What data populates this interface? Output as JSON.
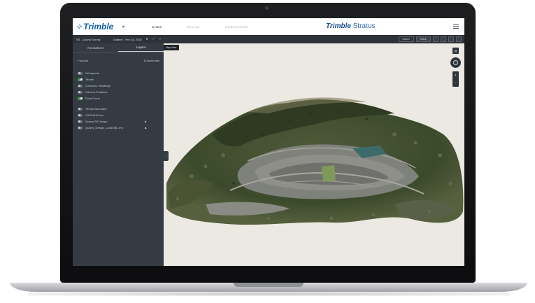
{
  "topbar": {
    "brand": "Trimble",
    "brand_mark": "⁘",
    "brand_caret": "▾",
    "tabs": [
      {
        "label": "SITES",
        "active": true
      },
      {
        "label": "DESIGN",
        "active": false
      },
      {
        "label": "WORKSPACES",
        "active": false
      }
    ],
    "product_brand": "Trimble",
    "product_name": "Stratus"
  },
  "toolbar": {
    "project": "SS - Quarry Survey",
    "dataset": "Dataset - Feb 18, 2018",
    "icons": [
      "pin-icon",
      "ruler-icon",
      "clock-icon"
    ],
    "export_label": "Export",
    "share_label": "Share",
    "tooltip": "Map View"
  },
  "sidebar": {
    "tabs": [
      {
        "label": "Annotations",
        "active": false
      },
      {
        "label": "Layers",
        "active": true
      }
    ],
    "upload_label": "+ Upload",
    "downloads_label": "⭳ Downloads",
    "layers": [
      {
        "label": "Orthophoto",
        "on": false,
        "arrow": false
      },
      {
        "label": "Terrain",
        "on": true,
        "arrow": false
      },
      {
        "label": "Contours / Heatmap",
        "on": false,
        "arrow": false
      },
      {
        "label": "Camera Positions",
        "on": false,
        "arrow": false
      },
      {
        "label": "Point Cloud",
        "on": true,
        "arrow": false
      },
      {
        "label": "Terrain Boundary",
        "on": false,
        "arrow": false,
        "gap": true
      },
      {
        "label": "CSVtoDXF.csv",
        "on": false,
        "arrow": false
      },
      {
        "label": "Quarry Pit Design",
        "on": false,
        "arrow": true
      },
      {
        "label": "Quarry_Design_LandXML.xml",
        "on": false,
        "arrow": true
      }
    ],
    "collapse_glyph": "‹"
  },
  "map": {
    "layers_glyph": "▤",
    "zoom_in": "+",
    "zoom_out": "−"
  }
}
